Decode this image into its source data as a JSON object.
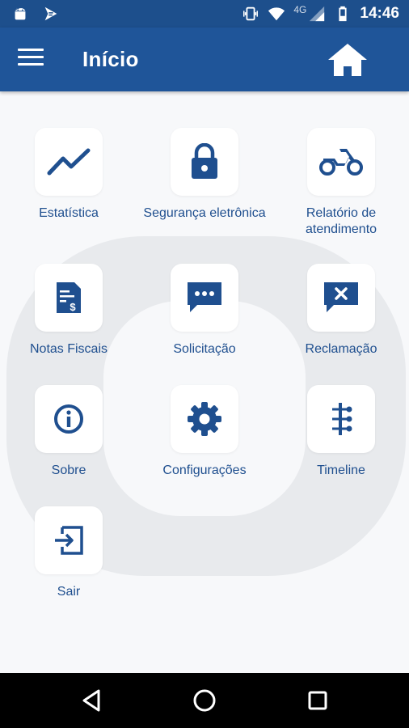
{
  "status_bar": {
    "time": "14:46",
    "network": "4G",
    "left_icons": [
      "android-icon",
      "notification-icon"
    ],
    "right_icons": [
      "vibrate-icon",
      "wifi-icon",
      "signal-icon",
      "battery-icon"
    ]
  },
  "app_bar": {
    "title": "Início",
    "menu_icon": "hamburger-menu-icon",
    "home_icon": "home-icon"
  },
  "menu_items": [
    {
      "label": "Estatística",
      "icon": "trending-up-icon"
    },
    {
      "label": "Segurança eletrônica",
      "icon": "lock-icon"
    },
    {
      "label": "Relatório de\natendimento",
      "icon": "motorcycle-icon"
    },
    {
      "label": "Notas Fiscais",
      "icon": "invoice-icon"
    },
    {
      "label": "Solicitação",
      "icon": "chat-dots-icon"
    },
    {
      "label": "Reclamação",
      "icon": "chat-x-icon"
    },
    {
      "label": "Sobre",
      "icon": "info-icon"
    },
    {
      "label": "Configurações",
      "icon": "gear-icon"
    },
    {
      "label": "Timeline",
      "icon": "timeline-icon"
    },
    {
      "label": "Sair",
      "icon": "exit-icon"
    }
  ],
  "nav_bar": {
    "buttons": [
      "back-icon",
      "home-circle-icon",
      "recents-icon"
    ]
  },
  "colors": {
    "primary": "#1f5599",
    "status_bar": "#1d4f8c",
    "icon": "#1f4f8f",
    "background": "#f7f8fa",
    "watermark": "#e8eaed"
  }
}
